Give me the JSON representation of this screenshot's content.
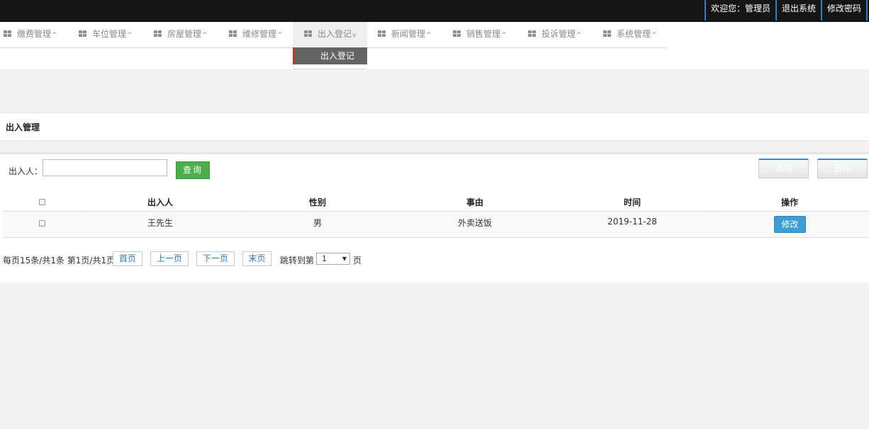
{
  "topbar": {
    "welcome": "欢迎您：管理员",
    "logout": "退出系统",
    "change_password": "修改密码"
  },
  "nav": {
    "items": [
      {
        "label": "缴费管理",
        "caret": "^"
      },
      {
        "label": "车位管理",
        "caret": "^"
      },
      {
        "label": "房屋管理",
        "caret": "^"
      },
      {
        "label": "维修管理",
        "caret": "^"
      },
      {
        "label": "出入登记",
        "caret": "v"
      },
      {
        "label": "新闻管理",
        "caret": "^"
      },
      {
        "label": "销售管理",
        "caret": "^"
      },
      {
        "label": "投诉管理",
        "caret": "^"
      },
      {
        "label": "系统管理",
        "caret": "^"
      }
    ],
    "submenu": "出入登记"
  },
  "section": {
    "title": "出入管理"
  },
  "search": {
    "label": "出入人：",
    "value": "",
    "query_button": "查询"
  },
  "actions": {
    "add": "添加",
    "delete": "删除"
  },
  "table": {
    "headers": [
      "出入人",
      "性别",
      "事由",
      "时间",
      "操作"
    ],
    "rows": [
      {
        "name": "王先生",
        "gender": "男",
        "reason": "外卖送饭",
        "time": "2019-11-28",
        "action": "修改"
      }
    ]
  },
  "pager": {
    "info": "每页15条/共1条 第1页/共1页",
    "first": "首页",
    "prev": "上一页",
    "next": "下一页",
    "last": "末页",
    "jump_label": "跳转到第",
    "page_value": "1",
    "page_suffix": "页"
  },
  "colors": {
    "topbar_bg": "#151515",
    "link_border": "#2b7fd0",
    "query_green": "#4cae4c",
    "edit_blue": "#3a9fd5",
    "submenu_bg": "#646464",
    "submenu_accent": "#c0392b"
  }
}
